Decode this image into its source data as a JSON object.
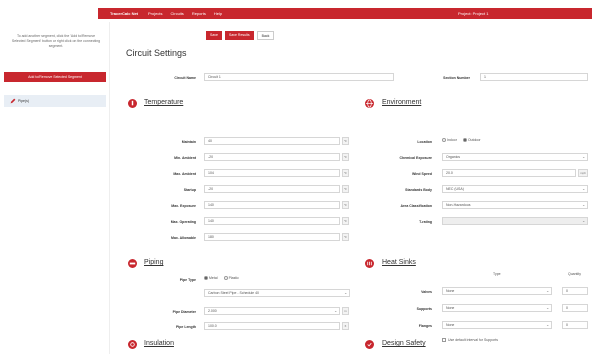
{
  "nav": {
    "brand": "TracerCalc Net",
    "items": [
      "Projects",
      "Circuits",
      "Reports",
      "Help"
    ],
    "project": "Project: Project 1"
  },
  "sidebar": {
    "hint": "To add another segment, click the 'Add to/Remove Selected Segment' button or right click on the connecting segment.",
    "add_button": "Add to/Remove Selected Segment",
    "tree_item": "Pipe(s)"
  },
  "toolbar": {
    "save": "Save",
    "save_results": "Save Results",
    "back": "Back"
  },
  "page_title": "Circuit Settings",
  "circuit": {
    "name_label": "Circuit Name",
    "name_value": "Circuit 1",
    "section_label": "Section Number",
    "section_value": "1"
  },
  "temperature": {
    "title": "Temperature",
    "fields": [
      {
        "label": "Maintain",
        "value": "40",
        "unit": "°F"
      },
      {
        "label": "Min. Ambient",
        "value": "-20",
        "unit": "°F"
      },
      {
        "label": "Max. Ambient",
        "value": "104",
        "unit": "°F"
      },
      {
        "label": "Startup",
        "value": "-20",
        "unit": "°F"
      },
      {
        "label": "Max. Exposure",
        "value": "140",
        "unit": "°F"
      },
      {
        "label": "Max. Operating",
        "value": "140",
        "unit": "°F"
      },
      {
        "label": "Max. Allowable",
        "value": "180",
        "unit": "°F"
      }
    ]
  },
  "environment": {
    "title": "Environment",
    "location_label": "Location",
    "location_options": [
      "Indoor",
      "Outdoor"
    ],
    "fields": [
      {
        "label": "Chemical Exposure",
        "value": "Organics"
      },
      {
        "label": "Wind Speed",
        "value": "20.0",
        "unit": "mph"
      },
      {
        "label": "Standards Body",
        "value": "NEC (USA)"
      },
      {
        "label": "Area Classification",
        "value": "Non-Hazardous"
      },
      {
        "label": "T-rating",
        "value": ""
      }
    ]
  },
  "piping": {
    "title": "Piping",
    "type_label": "Pipe Type",
    "type_options": [
      "Metal",
      "Plastic"
    ],
    "material": "Carbon Steel Pipe - Schedule 40",
    "diameter_label": "Pipe Diameter",
    "diameter_value": "2.000",
    "diameter_unit": "in",
    "length_label": "Pipe Length",
    "length_value": "100.0",
    "length_unit": "ft"
  },
  "heat_sinks": {
    "title": "Heat Sinks",
    "col_type": "Type",
    "col_qty": "Quantity",
    "rows": [
      {
        "label": "Valves",
        "type": "None",
        "qty": "0"
      },
      {
        "label": "Supports",
        "type": "None",
        "qty": "0"
      },
      {
        "label": "Flanges",
        "type": "None",
        "qty": "0"
      }
    ],
    "check_label": "Use default interval for Supports"
  },
  "insulation": {
    "title": "Insulation"
  },
  "design_safety": {
    "title": "Design Safety"
  },
  "colors": {
    "accent": "#c8272e"
  }
}
